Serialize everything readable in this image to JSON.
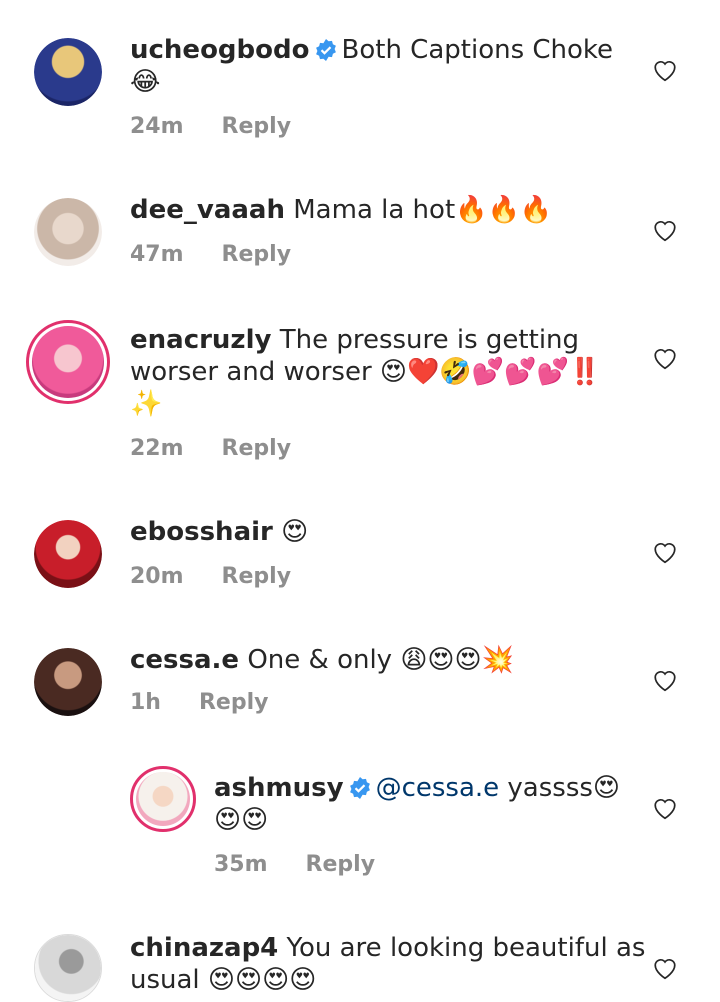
{
  "comments": [
    {
      "username": "ucheogbodo",
      "verified": true,
      "line1": "Both Captions Choke",
      "line2": "😂",
      "time": "24m",
      "reply": "Reply"
    },
    {
      "username": "dee_vaaah",
      "verified": false,
      "line1": "Mama la hot🔥🔥🔥",
      "time": "47m",
      "reply": "Reply"
    },
    {
      "username": "enacruzly",
      "verified": false,
      "line1": "The pressure is getting",
      "line2": "worser and worser 😍❤️🤣💕💕💕‼️",
      "line3": "✨",
      "time": "22m",
      "reply": "Reply"
    },
    {
      "username": "ebosshair",
      "verified": false,
      "line1": "😍",
      "time": "20m",
      "reply": "Reply"
    },
    {
      "username": "cessa.e",
      "verified": false,
      "line1": "One & only 😩😍😍💥",
      "time": "1h",
      "reply": "Reply"
    },
    {
      "username": "ashmusy",
      "verified": true,
      "mention": "@cessa.e",
      "line1": "yassss😍",
      "line2": "😍😍",
      "time": "35m",
      "reply": "Reply"
    },
    {
      "username": "chinazap4",
      "verified": false,
      "line1": "You are looking beautiful as",
      "line2": "usual 😍😍😍😍"
    }
  ]
}
